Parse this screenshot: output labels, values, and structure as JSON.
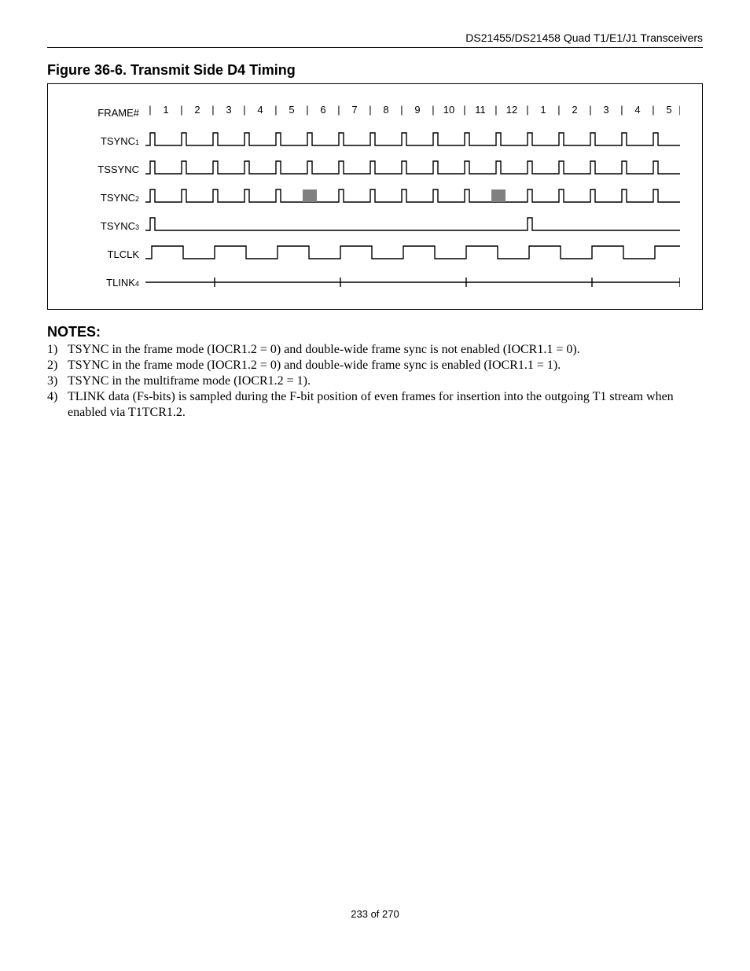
{
  "header": {
    "doc_title": "DS21455/DS21458 Quad T1/E1/J1 Transceivers"
  },
  "figure": {
    "title": "Figure 36-6. Transmit Side D4 Timing",
    "frame_label": "FRAME#",
    "frame_numbers": [
      1,
      2,
      3,
      4,
      5,
      6,
      7,
      8,
      9,
      10,
      11,
      12,
      1,
      2,
      3,
      4,
      5
    ],
    "signals": [
      {
        "name": "TSYNC",
        "sup": "1"
      },
      {
        "name": "TSSYNC",
        "sup": ""
      },
      {
        "name": "TSYNC",
        "sup": "2"
      },
      {
        "name": "TSYNC",
        "sup": "3"
      },
      {
        "name": "TLCLK",
        "sup": ""
      },
      {
        "name": "TLINK",
        "sup": "4"
      }
    ]
  },
  "notes": {
    "heading": "NOTES:",
    "items": [
      {
        "num": "1)",
        "text": "TSYNC in the frame mode (IOCR1.2 = 0) and double-wide frame sync is not enabled (IOCR1.1 = 0)."
      },
      {
        "num": "2)",
        "text": "TSYNC in the frame mode (IOCR1.2 = 0) and double-wide frame sync is enabled (IOCR1.1 = 1)."
      },
      {
        "num": "3)",
        "text": "TSYNC in the multiframe mode (IOCR1.2 = 1)."
      },
      {
        "num": "4)",
        "text": "TLINK data (Fs-bits) is sampled during the F-bit position of even frames for insertion into the outgoing T1 stream when enabled via T1TCR1.2."
      }
    ]
  },
  "footer": {
    "page": "233 of 270"
  }
}
